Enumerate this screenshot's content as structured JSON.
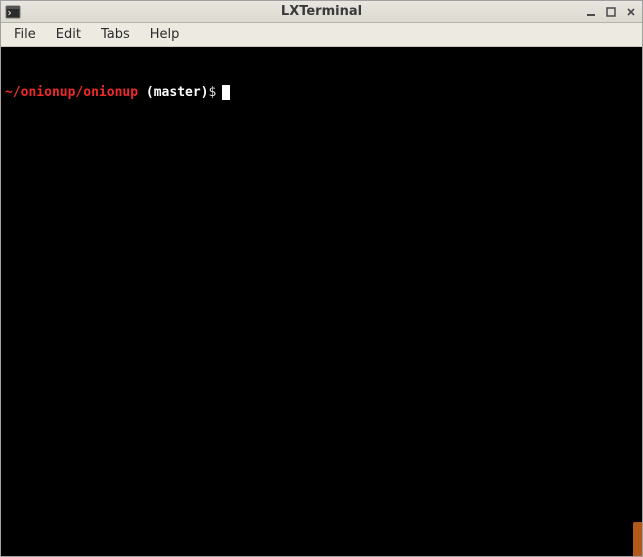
{
  "window": {
    "title": "LXTerminal"
  },
  "menubar": {
    "items": [
      {
        "label": "File"
      },
      {
        "label": "Edit"
      },
      {
        "label": "Tabs"
      },
      {
        "label": "Help"
      }
    ]
  },
  "terminal": {
    "prompt_path": "~/onionup/onionup ",
    "prompt_branch": "(master)",
    "prompt_symbol": "$",
    "command": ""
  },
  "controls": {
    "minimize": "minimize",
    "maximize": "maximize",
    "close": "close"
  }
}
